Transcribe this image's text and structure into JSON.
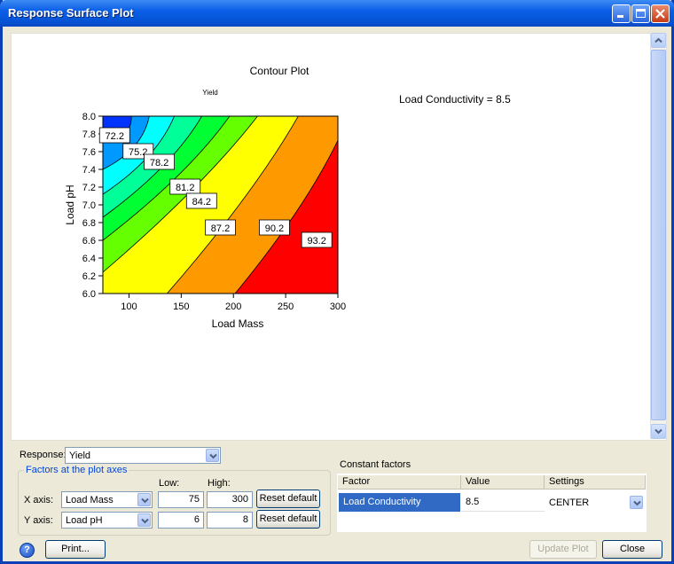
{
  "window": {
    "title": "Response Surface Plot"
  },
  "plot": {
    "title": "Contour Plot",
    "subtitle": "Yield",
    "constant_note": "Load Conductivity = 8.5",
    "colors": [
      "#0033ff",
      "#0099ff",
      "#00ffff",
      "#00ff99",
      "#00ff33",
      "#66ff00",
      "#ffff00",
      "#ff9900",
      "#ff0000"
    ]
  },
  "chart_data": {
    "type": "contour",
    "title": "Contour Plot",
    "subtitle": "Yield",
    "xlabel": "Load Mass",
    "ylabel": "Load pH",
    "xlim": [
      75,
      300
    ],
    "ylim": [
      6.0,
      8.0
    ],
    "x_ticks": [
      "100",
      "150",
      "200",
      "250",
      "300"
    ],
    "y_ticks": [
      "6.0",
      "6.2",
      "6.4",
      "6.6",
      "6.8",
      "7.0",
      "7.2",
      "7.4",
      "7.6",
      "7.8",
      "8.0"
    ],
    "contour_levels": [
      "72.2",
      "75.2",
      "78.2",
      "81.2",
      "84.2",
      "87.2",
      "90.2",
      "93.2"
    ]
  },
  "controls": {
    "response_label": "Response:",
    "response_value": "Yield",
    "factors_title": "Factors at the plot axes",
    "low_label": "Low:",
    "high_label": "High:",
    "x_axis_label": "X axis:",
    "x_axis_value": "Load Mass",
    "x_low": "75",
    "x_high": "300",
    "y_axis_label": "Y axis:",
    "y_axis_value": "Load pH",
    "y_low": "6",
    "y_high": "8",
    "reset_label": "Reset default"
  },
  "constant_factors": {
    "title": "Constant factors",
    "headers": [
      "Factor",
      "Value",
      "Settings"
    ],
    "rows": [
      {
        "factor": "Load Conductivity",
        "value": "8.5",
        "setting": "CENTER"
      }
    ]
  },
  "buttons": {
    "print": "Print...",
    "update_plot": "Update Plot",
    "close": "Close",
    "help": "?"
  }
}
